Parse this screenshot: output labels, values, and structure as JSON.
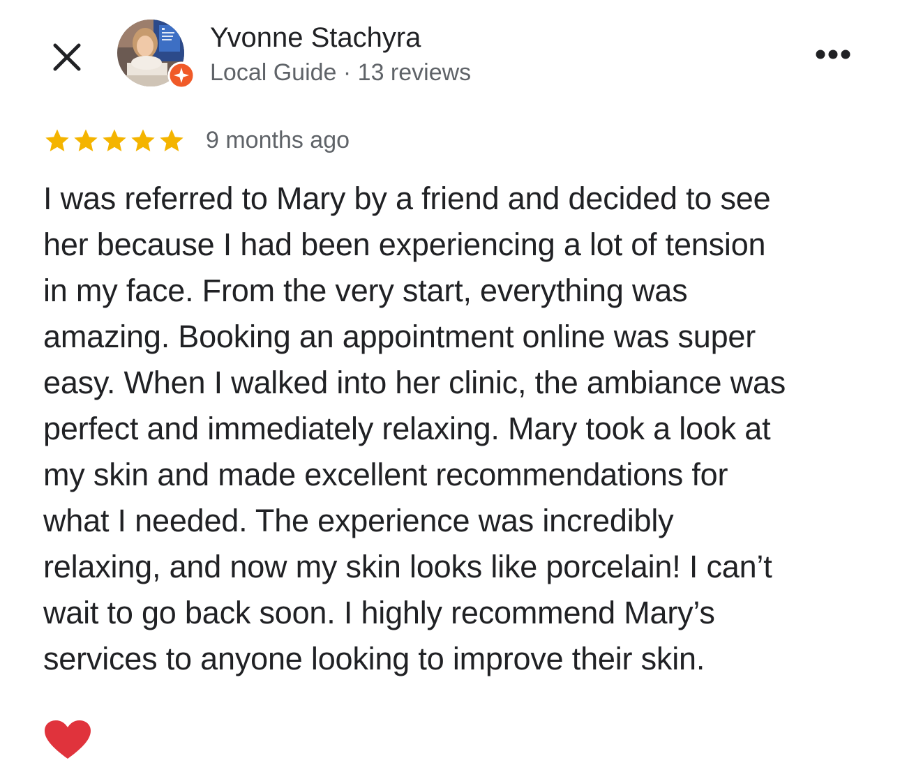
{
  "reviewer": {
    "name": "Yvonne Stachyra",
    "meta": "Local Guide · 13 reviews"
  },
  "review": {
    "rating": 5,
    "rating_max": 5,
    "date": "9 months ago",
    "lines": [
      "I was referred to Mary by a friend and decided to see",
      "her because I had been experiencing a lot of tension",
      "in my face. From the very start, everything was",
      "amazing. Booking an appointment online was super",
      "easy. When I walked into her clinic, the ambiance was",
      "perfect and immediately relaxing. Mary took a look at",
      "my skin and made excellent recommendations for",
      "what I needed. The experience was incredibly",
      "relaxing, and now my skin looks like porcelain! I can’t",
      "wait to go back soon. I highly recommend Mary’s",
      "services to anyone looking to improve their skin."
    ]
  },
  "icons": {
    "close": "close-icon",
    "more": "more-horizontal-icon",
    "star": "star-icon",
    "local_guide_badge": "local-guide-badge-icon",
    "heart": "heart-emoji-icon"
  },
  "colors": {
    "star": "#F4B400",
    "badge": "#F05A28",
    "text_primary": "#202124",
    "text_secondary": "#5f6368",
    "heart": "#E0333C"
  }
}
